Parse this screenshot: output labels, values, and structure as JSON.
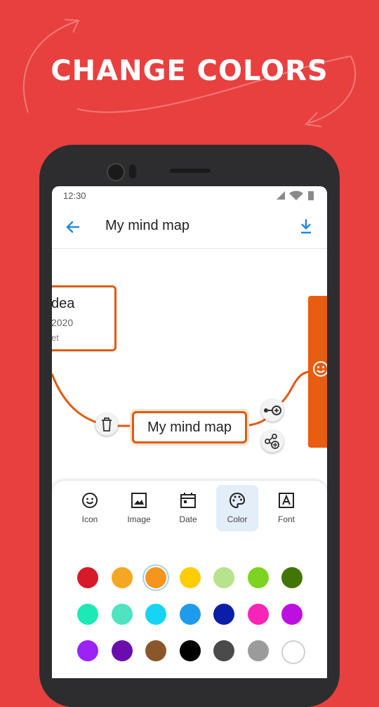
{
  "headline": "CHANGE COLORS",
  "status": {
    "time": "12:30"
  },
  "appbar": {
    "title": "My mind map"
  },
  "canvas": {
    "idea_node": {
      "title": "dea",
      "date": "2020",
      "note": "et"
    },
    "main_node": {
      "label": "My mind map"
    }
  },
  "tabs": [
    {
      "label": "Icon",
      "icon": "emoji-icon"
    },
    {
      "label": "Image",
      "icon": "image-icon"
    },
    {
      "label": "Date",
      "icon": "calendar-icon"
    },
    {
      "label": "Color",
      "icon": "palette-icon",
      "selected": true
    },
    {
      "label": "Font",
      "icon": "font-icon"
    }
  ],
  "palette": {
    "selected": "#f7941d",
    "colors": [
      [
        "#d71a2a",
        "#f5a623",
        "#f7941d",
        "#ffcc00",
        "#b7e38a",
        "#7ed321",
        "#417505"
      ],
      [
        "#1de9b6",
        "#50e3c2",
        "#17d4f5",
        "#1e9ceb",
        "#0a1ea6",
        "#f724b8",
        "#bd10e0"
      ],
      [
        "#9b24f5",
        "#6a0dad",
        "#8b572a",
        "#000000",
        "#4a4a4a",
        "#9b9b9b",
        "#ffffff"
      ]
    ]
  },
  "colors": {
    "background": "#e8403f",
    "accent_orange": "#e05a0f",
    "link_blue": "#1e88e5"
  }
}
